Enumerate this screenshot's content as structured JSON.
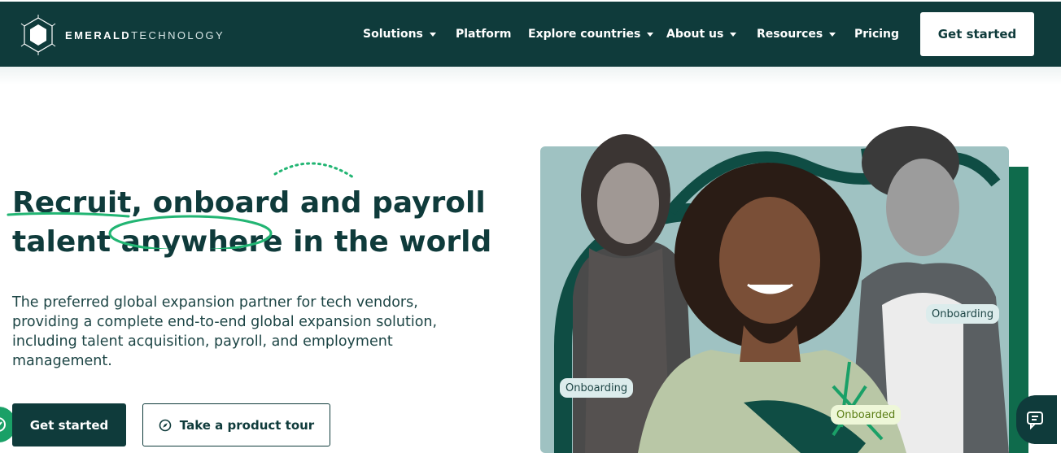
{
  "brand": {
    "name_bold": "EMERALD",
    "name_light": "TECHNOLOGY",
    "colors": {
      "primary": "#0f3b3b",
      "accent": "#22b573",
      "white": "#ffffff"
    }
  },
  "nav": {
    "items": [
      {
        "label": "Solutions",
        "dropdown": true
      },
      {
        "label": "Platform",
        "dropdown": false
      },
      {
        "label": "Explore countries",
        "dropdown": true
      },
      {
        "label": "About us",
        "dropdown": true
      },
      {
        "label": "Resources",
        "dropdown": true
      },
      {
        "label": "Pricing",
        "dropdown": false
      }
    ],
    "cta_label": "Get started"
  },
  "hero": {
    "headline": {
      "w1": "Recruit",
      "w2": ", onboard and payroll",
      "w3": "talent",
      "w4": "anywhere",
      "w5": "in the world"
    },
    "lead": "The preferred global expansion partner for tech vendors, providing a complete end-to-end global expansion solution, including talent acquisition, payroll, and employment management.",
    "primary_cta": "Get started",
    "secondary_cta": "Take a product tour",
    "secondary_icon": "compass-icon",
    "badges": {
      "b1": "Onboarding",
      "b2": "Onboarding",
      "b3": "Onboarded"
    }
  }
}
